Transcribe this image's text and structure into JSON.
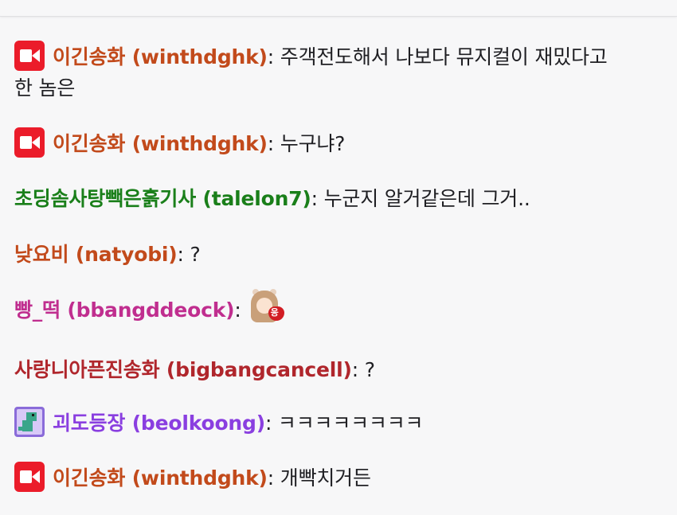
{
  "colors": {
    "background": "#f7f7f8",
    "text": "#1f1f23",
    "user_orange": "#c24a1b",
    "user_green": "#1a7f1a",
    "user_magenta": "#c02e8f",
    "user_red": "#b0262c",
    "user_purple": "#8a3fe0",
    "cam_badge": "#eb1c2a"
  },
  "messages": [
    {
      "badge": "camera-icon",
      "user": "이긴송화 (winthdghk)",
      "text": ": 주객전도해서 나보다 뮤지컬이 재밌다고",
      "text2": "한 놈은"
    },
    {
      "badge": "camera-icon",
      "user": "이긴송화 (winthdghk)",
      "text": ": 누구냐?"
    },
    {
      "badge": "",
      "user": "초딩솜사탕빽은흙기사 (talelon7)",
      "text": ": 누군지 알거같은데 그거.."
    },
    {
      "badge": "",
      "user": "낮요비 (natyobi)",
      "text": ": ?"
    },
    {
      "badge": "",
      "user": "빵_떡 (bbangddeock)",
      "text": ":",
      "emote": "girl-heart-emote",
      "emote_text": "응"
    },
    {
      "badge": "",
      "user": "사랑니아픈진송화 (bigbangcancell)",
      "text": ": ?"
    },
    {
      "badge": "dino-icon",
      "user": "괴도등장 (beolkoong)",
      "text": ": ㅋㅋㅋㅋㅋㅋㅋㅋ"
    },
    {
      "badge": "camera-icon",
      "user": "이긴송화 (winthdghk)",
      "text": ": 개빡치거든"
    }
  ]
}
